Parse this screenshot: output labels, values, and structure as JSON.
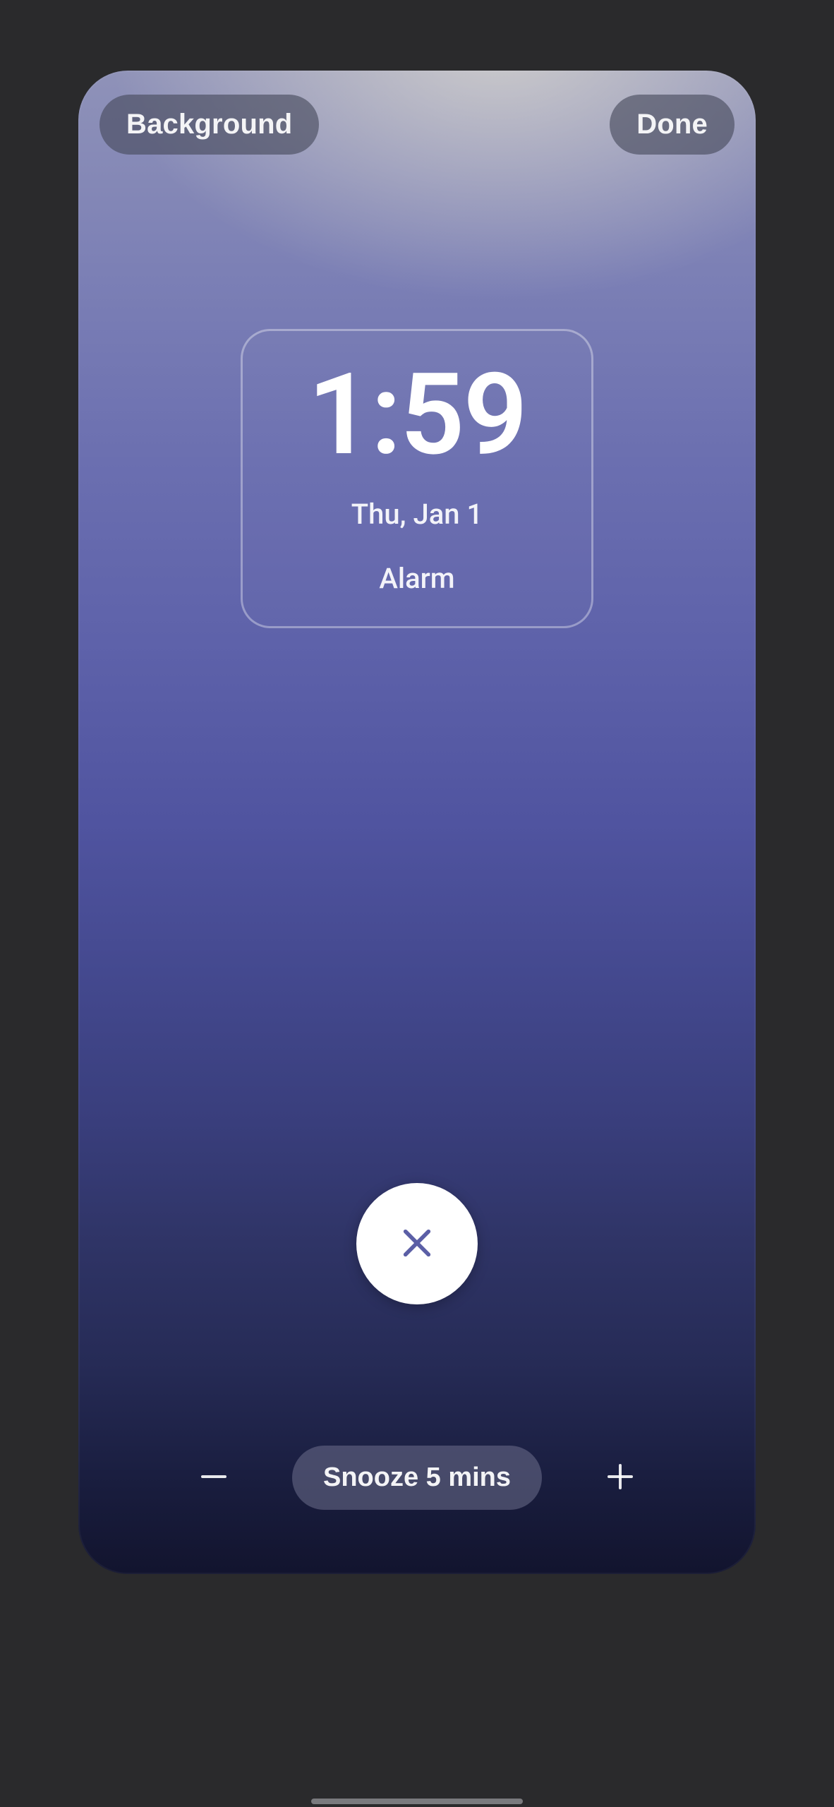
{
  "header": {
    "background_label": "Background",
    "done_label": "Done"
  },
  "clock": {
    "time": "1:59",
    "date": "Thu, Jan 1",
    "label": "Alarm"
  },
  "snooze": {
    "chip_label": "Snooze 5 mins"
  },
  "colors": {
    "accent": "#5b5fa6"
  }
}
